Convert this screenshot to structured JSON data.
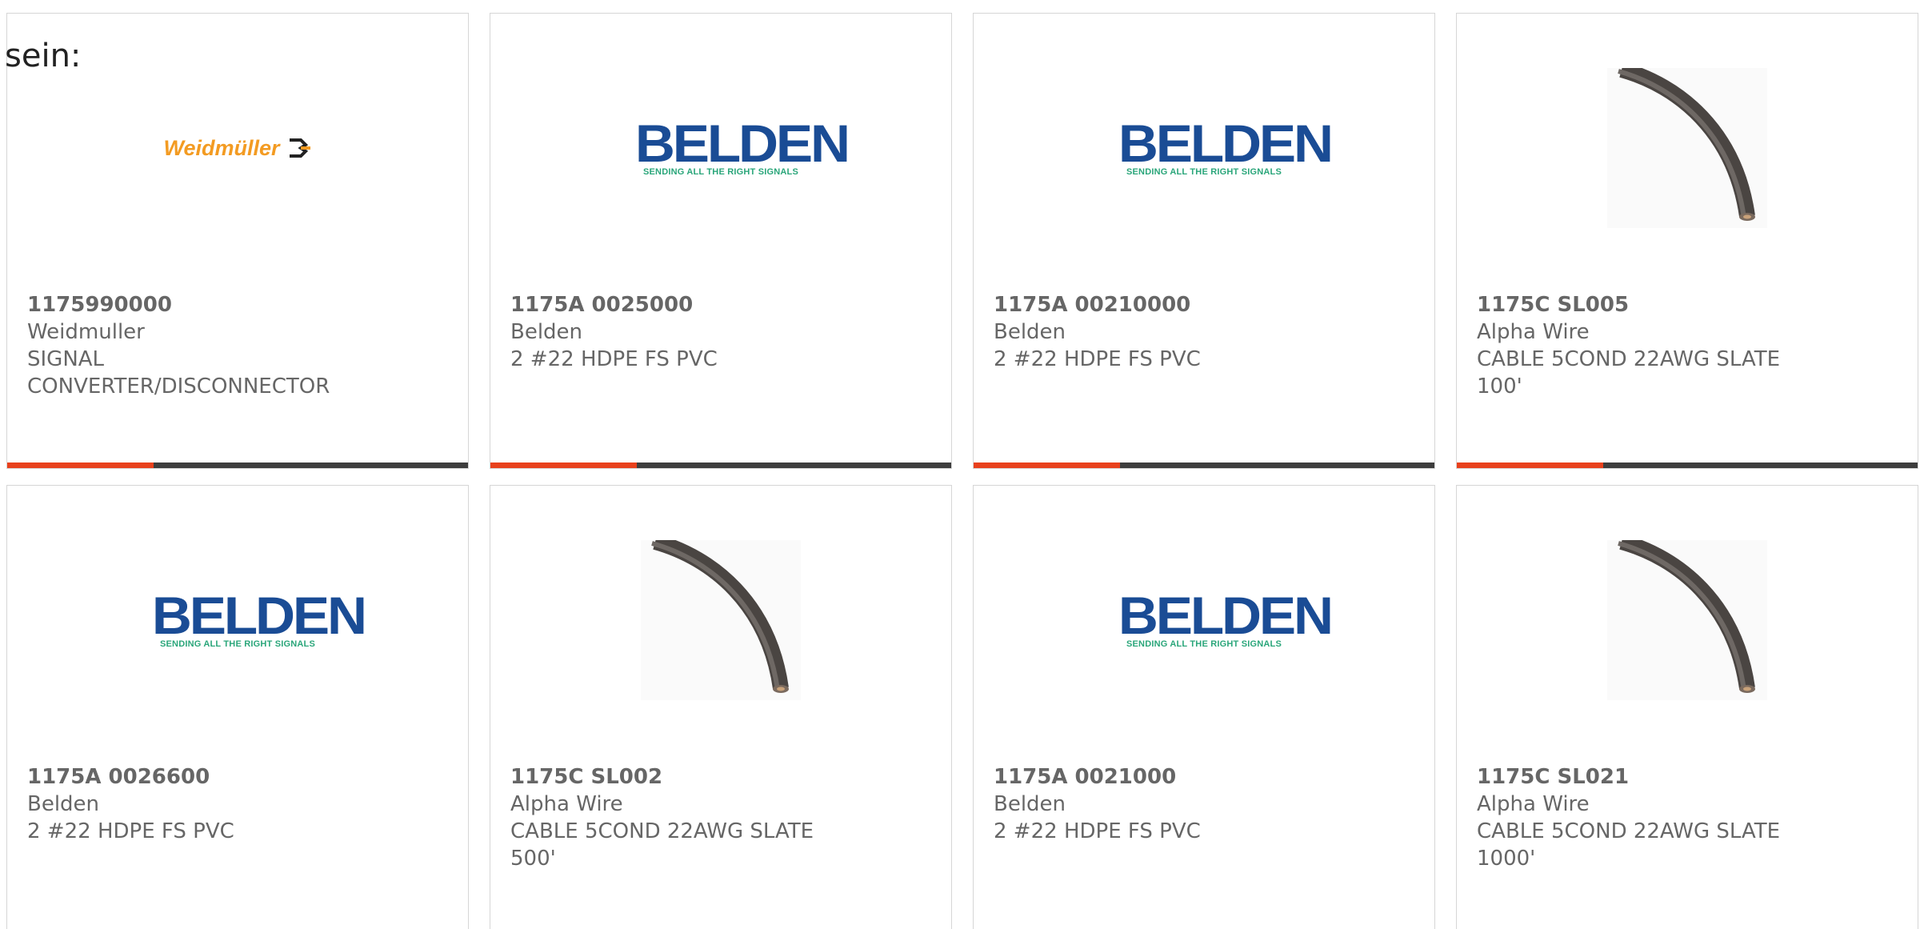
{
  "intro_text": "sein:",
  "colors": {
    "accent_bar": "#e8401c",
    "dark_bar": "#3d3d3d",
    "belden_blue": "#1a4c95",
    "belden_green": "#2aa67a",
    "weidmuller_orange": "#f39b22",
    "text": "#666666"
  },
  "logos": {
    "belden_word": "BELDEN",
    "belden_tagline": "SENDING ALL THE RIGHT SIGNALS",
    "weidmuller_word": "Weidmüller"
  },
  "products": [
    {
      "part_number": "1175990000",
      "manufacturer": "Weidmuller",
      "description": "SIGNAL CONVERTER/DISCONNECTOR",
      "image": "weidmuller-logo"
    },
    {
      "part_number": "1175A 0025000",
      "manufacturer": "Belden",
      "description": "2 #22 HDPE FS PVC",
      "image": "belden-logo"
    },
    {
      "part_number": "1175A 00210000",
      "manufacturer": "Belden",
      "description": "2 #22 HDPE FS PVC",
      "image": "belden-logo"
    },
    {
      "part_number": "1175C SL005",
      "manufacturer": "Alpha Wire",
      "description": "CABLE 5COND 22AWG SLATE 100'",
      "image": "cable-photo"
    },
    {
      "part_number": "1175A 0026600",
      "manufacturer": "Belden",
      "description": "2 #22 HDPE FS PVC",
      "image": "belden-logo"
    },
    {
      "part_number": "1175C SL002",
      "manufacturer": "Alpha Wire",
      "description": "CABLE 5COND 22AWG SLATE 500'",
      "image": "cable-photo"
    },
    {
      "part_number": "1175A 0021000",
      "manufacturer": "Belden",
      "description": "2 #22 HDPE FS PVC",
      "image": "belden-logo"
    },
    {
      "part_number": "1175C SL021",
      "manufacturer": "Alpha Wire",
      "description": "CABLE 5COND 22AWG SLATE 1000'",
      "image": "cable-photo"
    }
  ]
}
